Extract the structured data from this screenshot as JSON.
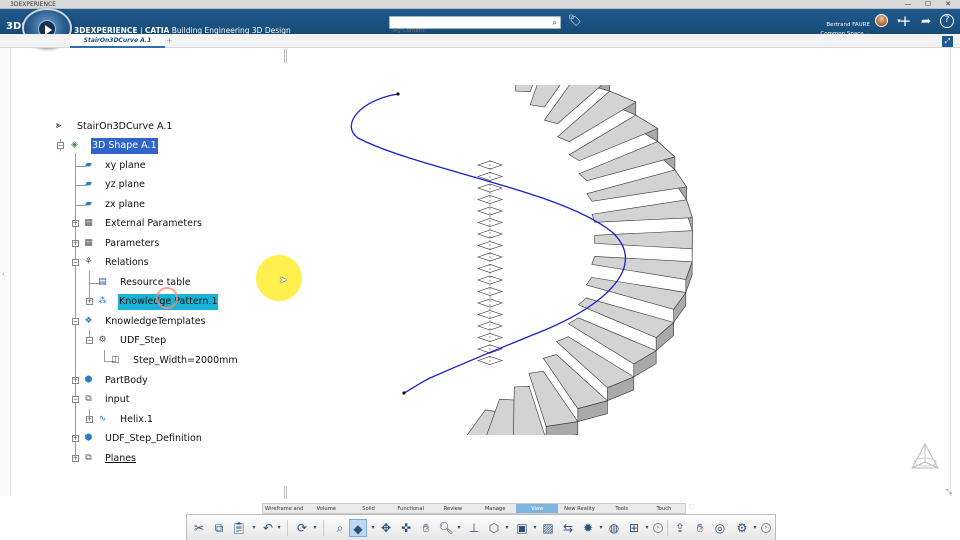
{
  "os": {
    "window_title": "3DEXPERIENCE",
    "controls": {
      "minimize": "—",
      "maximize": "☐",
      "close": "✕"
    }
  },
  "header": {
    "brand_bold": "3DEXPERIENCE",
    "brand_sep": " | ",
    "brand_app": "CATIA",
    "app_name": " Building Engineering 3D Design",
    "logo": "3DS",
    "search_placeholder": "My Content",
    "user_name": "Bertrand FAURE",
    "user_space": "Common Space",
    "icons": [
      "tag-icon",
      "plus-icon",
      "share-icon",
      "help-icon"
    ]
  },
  "tabs": [
    {
      "label": "StairOn3DCurve A.1"
    }
  ],
  "tree": {
    "root": "StairOn3DCurve A.1",
    "items": [
      {
        "label": "3D Shape A.1",
        "icon": "shape-icon"
      },
      {
        "label": "xy plane",
        "icon": "plane-icon"
      },
      {
        "label": "yz plane",
        "icon": "plane-icon"
      },
      {
        "label": "zx plane",
        "icon": "plane-icon"
      },
      {
        "label": "External Parameters",
        "icon": "parameters-icon"
      },
      {
        "label": "Parameters",
        "icon": "parameters-icon"
      },
      {
        "label": "Relations",
        "icon": "relations-icon"
      },
      {
        "label": "Resource table",
        "icon": "table-icon"
      },
      {
        "label": "Knowledge Pattern.1",
        "icon": "pattern-icon"
      },
      {
        "label": "KnowledgeTemplates",
        "icon": "template-icon"
      },
      {
        "label": "UDF_Step",
        "icon": "udf-icon"
      },
      {
        "label": "Step_Width=2000mm",
        "icon": "parameter-icon"
      },
      {
        "label": "PartBody",
        "icon": "body-icon"
      },
      {
        "label": "input",
        "icon": "geoset-icon"
      },
      {
        "label": "Helix.1",
        "icon": "helix-icon"
      },
      {
        "label": "UDF_Step_Definition",
        "icon": "udf-def-icon"
      },
      {
        "label": "Planes",
        "icon": "geoset-icon"
      }
    ]
  },
  "action_bar": {
    "sections": [
      "Wireframe and Surface",
      "Volume",
      "Solid",
      "Functional",
      "Review",
      "Manage",
      "View",
      "New Reality",
      "Tools",
      "Touch"
    ],
    "active_section": "View"
  },
  "colors": {
    "header": "#1e5a8c",
    "selection_blue": "#3064c8",
    "selection_cyan": "#18b4d8",
    "curve": "#1a22c8",
    "highlight": "#ffee40"
  }
}
